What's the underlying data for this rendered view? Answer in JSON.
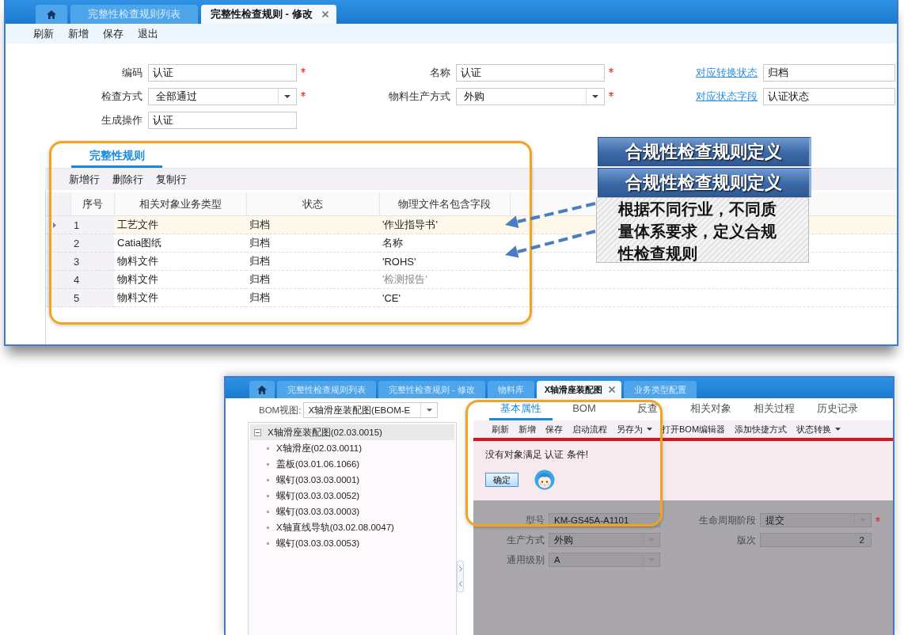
{
  "window_1": {
    "tabs": [
      {
        "kind": "home",
        "selected": false,
        "closable": false
      },
      {
        "kind": "text",
        "label": "完整性检查规则列表",
        "selected": false,
        "closable": false
      },
      {
        "kind": "text",
        "label": "完整性检查规则 - 修改",
        "selected": true,
        "closable": true
      }
    ],
    "toolbar": [
      "刷新",
      "新增",
      "保存",
      "退出"
    ],
    "form": [
      [
        {
          "label": "编码",
          "value": "认证",
          "kind": "text",
          "required": true,
          "label_link": false
        },
        {
          "label": "名称",
          "value": "认证",
          "kind": "text",
          "required": true,
          "label_link": false
        },
        {
          "label": "对应转换状态",
          "value": "归档",
          "kind": "text",
          "required": false,
          "label_link": true
        }
      ],
      [
        {
          "label": "检查方式",
          "value": "全部通过",
          "kind": "dropdown",
          "required": true,
          "label_link": false
        },
        {
          "label": "物料生产方式",
          "value": "外购",
          "kind": "dropdown",
          "required": true,
          "label_link": false
        },
        {
          "label": "对应状态字段",
          "value": "认证状态",
          "kind": "text",
          "required": false,
          "label_link": true
        }
      ],
      [
        {
          "label": "生成操作",
          "value": "认证",
          "kind": "text",
          "required": false,
          "label_link": false
        }
      ]
    ],
    "rules": {
      "tabs": [
        {
          "label": "完整性规则",
          "selected": true
        }
      ],
      "toolbar": [
        "新增行",
        "删除行",
        "复制行"
      ],
      "columns": [
        "序号",
        "相关对象业务类型",
        "状态",
        "物理文件名包含字段"
      ],
      "rows": [
        {
          "cells": [
            "1",
            "工艺文件",
            "归档",
            "'作业指导书'"
          ],
          "selected": true,
          "field_dimmed": false
        },
        {
          "cells": [
            "2",
            "Catia图纸",
            "归档",
            "名称"
          ],
          "selected": false,
          "field_dimmed": false
        },
        {
          "cells": [
            "3",
            "物料文件",
            "归档",
            "'ROHS'"
          ],
          "selected": false,
          "field_dimmed": false
        },
        {
          "cells": [
            "4",
            "物料文件",
            "归档",
            "'检测报告'"
          ],
          "selected": false,
          "field_dimmed": true
        },
        {
          "cells": [
            "5",
            "物料文件",
            "归档",
            "'CE'"
          ],
          "selected": false,
          "field_dimmed": false
        }
      ]
    }
  },
  "callout": {
    "titles": [
      "合规性检查规则定义",
      "合规性检查规则定义"
    ],
    "body": "根据不同行业，不同质量体系要求，定义合规性检查规则"
  },
  "window_2": {
    "tabs": [
      {
        "kind": "home",
        "selected": false,
        "closable": false
      },
      {
        "kind": "text",
        "label": "完整性检查规则列表",
        "selected": false,
        "closable": false
      },
      {
        "kind": "text",
        "label": "完整性检查规则 - 修改",
        "selected": false,
        "closable": false
      },
      {
        "kind": "text",
        "label": "物料库",
        "selected": false,
        "closable": false
      },
      {
        "kind": "text",
        "label": "X轴滑座装配图",
        "selected": true,
        "closable": true
      },
      {
        "kind": "text",
        "label": "业务类型配置",
        "selected": false,
        "closable": false
      }
    ],
    "bom_view": {
      "label": "BOM视图:",
      "value": "X轴滑座装配图(EBOM-E"
    },
    "tree": [
      {
        "label": "X轴滑座装配图(02.03.0015)",
        "selected": true,
        "expanded": true,
        "children": [
          {
            "label": "X轴滑座(02.03.0011)",
            "selected": false
          },
          {
            "label": "盖板(03.01.06.1066)",
            "selected": false
          },
          {
            "label": "螺钉(03.03.03.0001)",
            "selected": false
          },
          {
            "label": "螺钉(03.03.03.0052)",
            "selected": false
          },
          {
            "label": "螺钉(03.03.03.0003)",
            "selected": false
          },
          {
            "label": "X轴直线导轨(03.02.08.0047)",
            "selected": false
          },
          {
            "label": "螺钉(03.03.03.0053)",
            "selected": false
          }
        ]
      }
    ],
    "detail_tabs": [
      {
        "label": "基本属性",
        "selected": true
      },
      {
        "label": "BOM",
        "selected": false
      },
      {
        "label": "反查",
        "selected": false
      },
      {
        "label": "相关对象",
        "selected": false
      },
      {
        "label": "相关过程",
        "selected": false
      },
      {
        "label": "历史记录",
        "selected": false
      }
    ],
    "toolbar": [
      {
        "label": "刷新",
        "has_menu": false
      },
      {
        "label": "新增",
        "has_menu": false
      },
      {
        "label": "保存",
        "has_menu": false
      },
      {
        "label": "启动流程",
        "has_menu": false
      },
      {
        "label": "另存为",
        "has_menu": true
      },
      {
        "label": "打开BOM编辑器",
        "has_menu": false
      },
      {
        "label": "添加快捷方式",
        "has_menu": false
      },
      {
        "label": "状态转换",
        "has_menu": true
      }
    ],
    "message": {
      "text": "没有对象满足 认证 条件!",
      "button": "确定"
    },
    "form": [
      [
        {
          "label": "型号",
          "value": "KM-GS45A-A1101",
          "kind": "text",
          "required": false
        },
        {
          "label": "生命周期阶段",
          "value": "提交",
          "kind": "dropdown",
          "required": true
        }
      ],
      [
        {
          "label": "生产方式",
          "value": "外购",
          "kind": "dropdown",
          "required": false
        },
        {
          "label": "版次",
          "value": "2",
          "kind": "number",
          "required": false
        }
      ],
      [
        {
          "label": "通用级别",
          "value": "A",
          "kind": "dropdown",
          "required": false
        }
      ]
    ]
  }
}
